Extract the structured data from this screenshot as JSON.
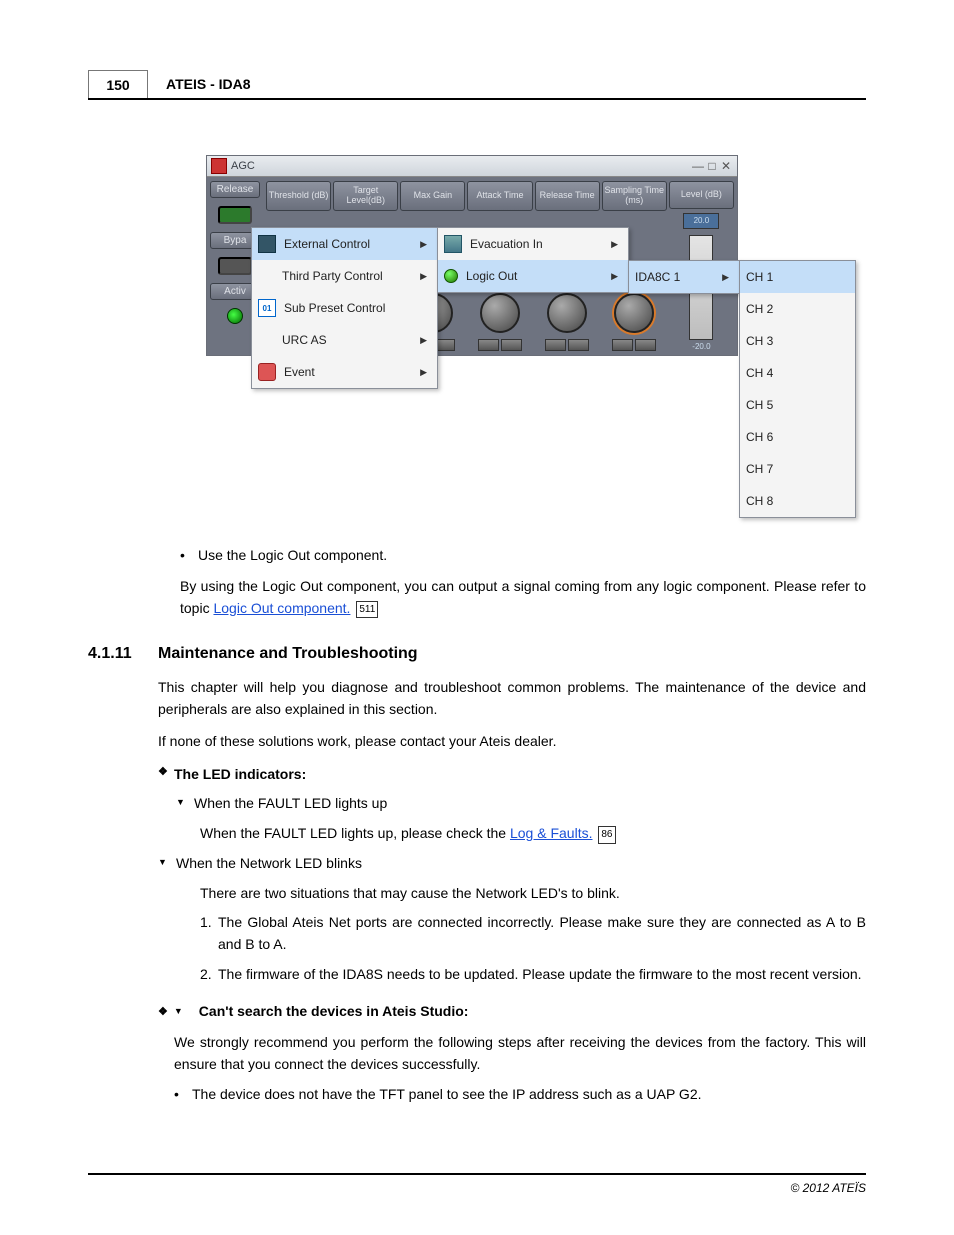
{
  "header": {
    "page_num": "150",
    "title": "ATEIS - IDA8"
  },
  "agc": {
    "title": "AGC",
    "left_buttons": [
      "Release",
      "Bypa",
      "Activ"
    ],
    "columns": [
      "Threshold (dB)",
      "Target Level(dB)",
      "Max Gain",
      "Attack Time",
      "Release Time",
      "Sampling Time (ms)",
      "Level (dB)"
    ],
    "level_top": "20.0",
    "level_bottom": "-20.0"
  },
  "menu1": {
    "items": [
      {
        "label": "External Control",
        "arrow": true,
        "highlight": true,
        "icon": "slider"
      },
      {
        "label": "Third Party Control",
        "arrow": true,
        "icon": "none"
      },
      {
        "label": "Sub Preset Control",
        "arrow": false,
        "icon": "num"
      },
      {
        "label": "URC AS",
        "arrow": true,
        "icon": "none"
      },
      {
        "label": "Event",
        "arrow": true,
        "icon": "event"
      }
    ]
  },
  "menu2": {
    "items": [
      {
        "label": "Evacuation In",
        "arrow": true,
        "icon": "levels"
      },
      {
        "label": "Logic Out",
        "arrow": true,
        "highlight": true,
        "icon": "green"
      }
    ]
  },
  "menu3": {
    "items": [
      {
        "label": "IDA8C 1",
        "arrow": true,
        "highlight": true
      }
    ]
  },
  "menu4": {
    "items": [
      {
        "label": "CH 1",
        "highlight": true
      },
      {
        "label": "CH 2"
      },
      {
        "label": "CH 3"
      },
      {
        "label": "CH 4"
      },
      {
        "label": "CH 5"
      },
      {
        "label": "CH 6"
      },
      {
        "label": "CH 7"
      },
      {
        "label": "CH 8"
      }
    ]
  },
  "content": {
    "bullet1": "Use the Logic Out component.",
    "para1_a": "By using the Logic Out component, you can output a signal coming from any logic component. Please refer to topic ",
    "link1": "Logic Out component.",
    "ref1": "511",
    "sec_num": "4.1.11",
    "sec_title": "Maintenance and Troubleshooting",
    "sub1": "This chapter will help you diagnose and troubleshoot common problems. The maintenance of the device and peripherals are also explained in this section.",
    "sub2": "If none of these solutions work, please contact your Ateis dealer.",
    "led_heading": "The LED indicators:",
    "tri1": "When the FAULT LED lights up",
    "inner1_a": "When the FAULT LED lights up, please check the ",
    "link2": "Log & Faults.",
    "ref2": "86",
    "tri2": "When the Network LED blinks",
    "inner2": "There are two situations that may cause the Network LED's to blink.",
    "num1": "The Global Ateis Net ports are connected incorrectly. Please make sure they are connected as A to B and B to A.",
    "num2": "The firmware of the IDA8S needs to be updated.  Please update the firmware to the most recent version.",
    "cant_search": "Can't search the devices in Ateis Studio:",
    "rec": "We strongly recommend you perform the following steps after receiving the devices from the factory. This will ensure that you connect the devices successfully.",
    "dot1": "The device does not have the TFT panel to see the IP address such as a UAP G2."
  },
  "footer": "© 2012 ATEÏS"
}
